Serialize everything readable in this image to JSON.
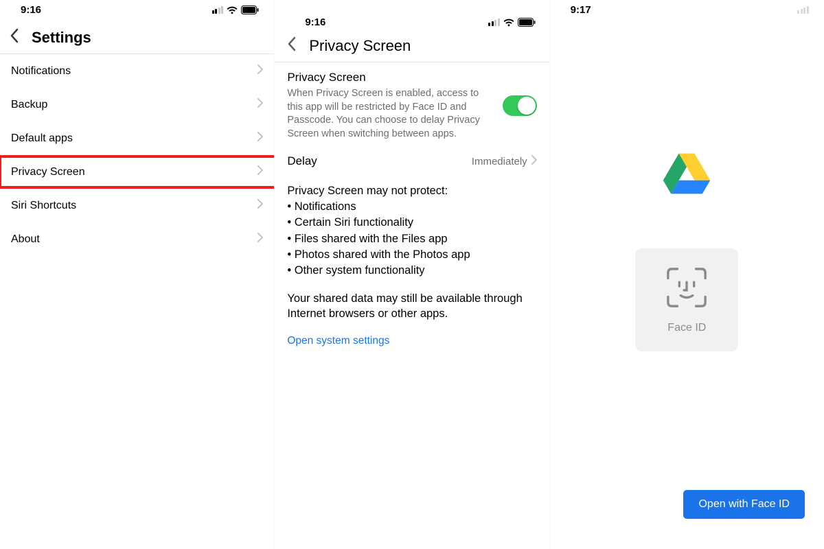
{
  "panel1": {
    "time": "9:16",
    "title": "Settings",
    "items": [
      {
        "label": "Notifications"
      },
      {
        "label": "Backup"
      },
      {
        "label": "Default apps"
      },
      {
        "label": "Privacy Screen"
      },
      {
        "label": "Siri Shortcuts"
      },
      {
        "label": "About"
      }
    ]
  },
  "panel2": {
    "time": "9:16",
    "title": "Privacy Screen",
    "section_title": "Privacy Screen",
    "section_desc": "When Privacy Screen is enabled, access to this app will be restricted by Face ID and Passcode. You can choose to delay Privacy Screen when switching between apps.",
    "delay_label": "Delay",
    "delay_value": "Immediately",
    "notprotect_heading": "Privacy Screen may not protect:",
    "notprotect_items": [
      "Notifications",
      "Certain Siri functionality",
      "Files shared with the Files app",
      "Photos shared with the Photos app",
      "Other system functionality"
    ],
    "shared_note": "Your shared data may still be available through Internet browsers or other apps.",
    "open_settings": "Open system settings"
  },
  "panel3": {
    "time": "9:17",
    "faceid_label": "Face ID",
    "open_button": "Open with Face ID"
  }
}
